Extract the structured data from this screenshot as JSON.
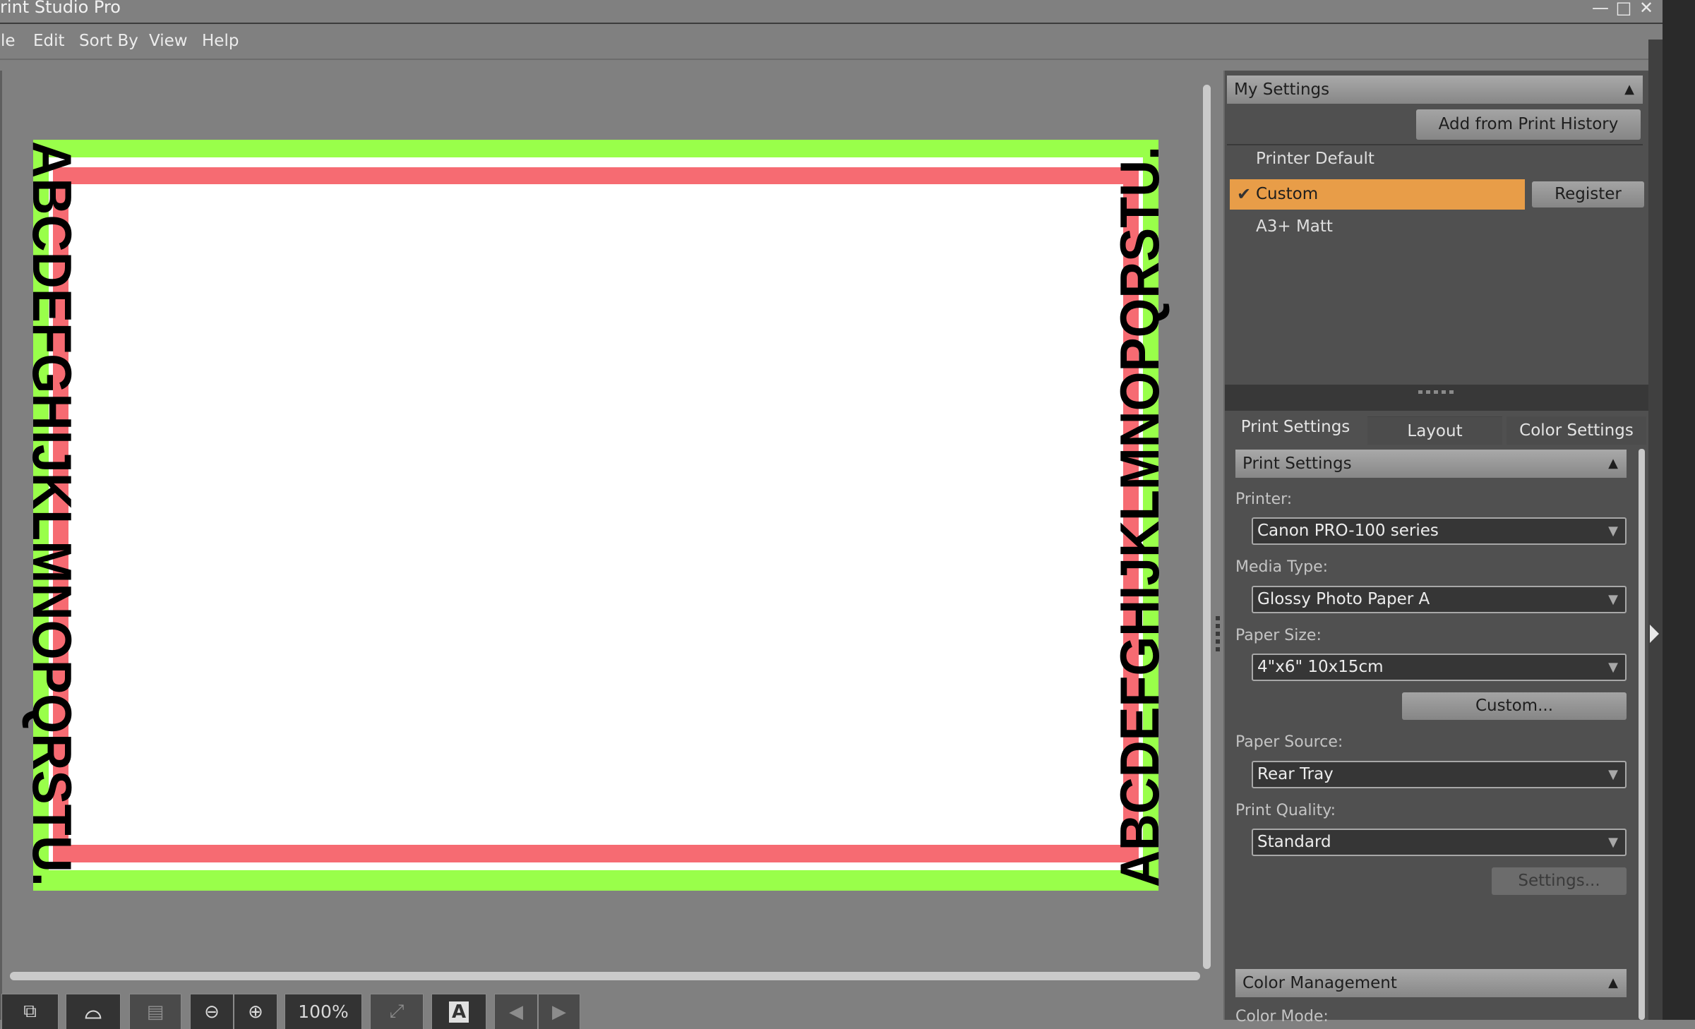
{
  "window": {
    "title": "Print Studio Pro",
    "minimize_icon": "minimize-icon",
    "maximize_icon": "maximize-icon",
    "close_icon": "close-icon"
  },
  "menu": [
    "File",
    "Edit",
    "Sort By",
    "View",
    "Help"
  ],
  "preview": {
    "left_text": "ABCDEFGHIJKLMNOPQRSTU.",
    "right_text": "ABCDEFGHIJKLMNOPQRSTU.",
    "colors": {
      "outer_band": "#99ff4a",
      "inner_band": "#f66b72",
      "paper": "#ffffff"
    }
  },
  "toolbar": {
    "buttons": [
      {
        "icon": "rotate-page-icon",
        "enabled": true
      },
      {
        "icon": "crop-icon",
        "enabled": true
      },
      {
        "icon": "layout-icon",
        "enabled": false
      },
      {
        "icon": "zoom-out-icon",
        "enabled": true
      },
      {
        "icon": "zoom-in-icon",
        "enabled": true
      },
      {
        "icon": "fit-screen-icon",
        "enabled": false
      },
      {
        "icon": "text-icon",
        "enabled": true
      },
      {
        "icon": "previous-icon",
        "enabled": false
      },
      {
        "icon": "next-icon",
        "enabled": false
      }
    ],
    "zoom_level": "100%"
  },
  "my_settings": {
    "header": "My Settings",
    "add_button": "Add from Print History",
    "items": [
      "Printer Default",
      "Custom",
      "A3+ Matt"
    ],
    "selected": "Custom",
    "register_button": "Register",
    "highlight_color": "#e89d48"
  },
  "tabs": [
    "Print Settings",
    "Layout",
    "Color Settings"
  ],
  "active_tab": "Print Settings",
  "print_settings": {
    "header": "Print Settings",
    "printer_label": "Printer:",
    "printer_value": "Canon PRO-100 series",
    "media_label": "Media Type:",
    "media_value": "Glossy Photo Paper A",
    "size_label": "Paper Size:",
    "size_value": "4\"x6\" 10x15cm",
    "custom_button": "Custom...",
    "source_label": "Paper Source:",
    "source_value": "Rear Tray",
    "quality_label": "Print Quality:",
    "quality_value": "Standard",
    "settings_button": "Settings..."
  },
  "color_management": {
    "header": "Color Management",
    "color_mode_label": "Color Mode:"
  }
}
